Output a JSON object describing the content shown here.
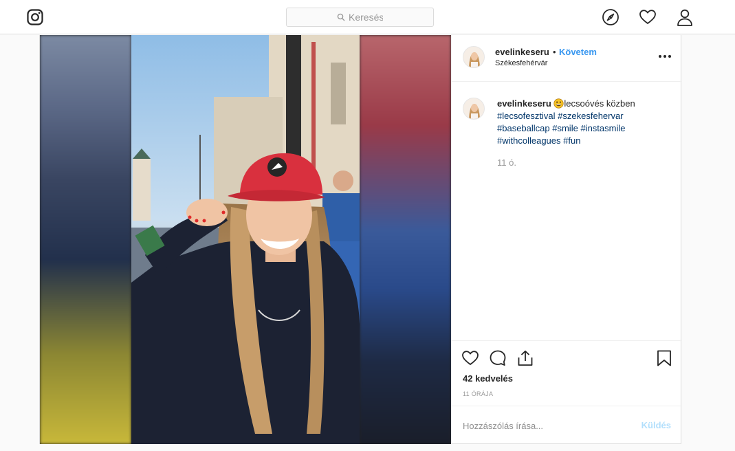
{
  "nav": {
    "search_placeholder": "Keresés",
    "icons": [
      "instagram-logo-icon",
      "search-icon",
      "compass-icon",
      "heart-icon",
      "profile-icon"
    ]
  },
  "post": {
    "username": "evelinkeseru",
    "separator": "•",
    "follow_label": "Követem",
    "location": "Székesfehérvár",
    "caption": {
      "username": "evelinkeseru",
      "emoji": "grinning-face-emoji",
      "text": "lecsoóvés közben",
      "hashtags": [
        "#lecsofesztival",
        "#szekesfehervar",
        "#baseballcap",
        "#smile",
        "#instasmile",
        "#withcolleagues",
        "#fun"
      ]
    },
    "comment_time": "11 ó.",
    "likes": "42 kedvelés",
    "time_ago": "11 ÓRÁJA",
    "comment_placeholder": "Hozzászólás írása...",
    "send_label": "Küldés"
  },
  "colors": {
    "link": "#3897f0",
    "hashtag": "#003569",
    "send_disabled": "#b2dffc",
    "border": "#dbdbdb",
    "cap_red": "#d9303e"
  }
}
